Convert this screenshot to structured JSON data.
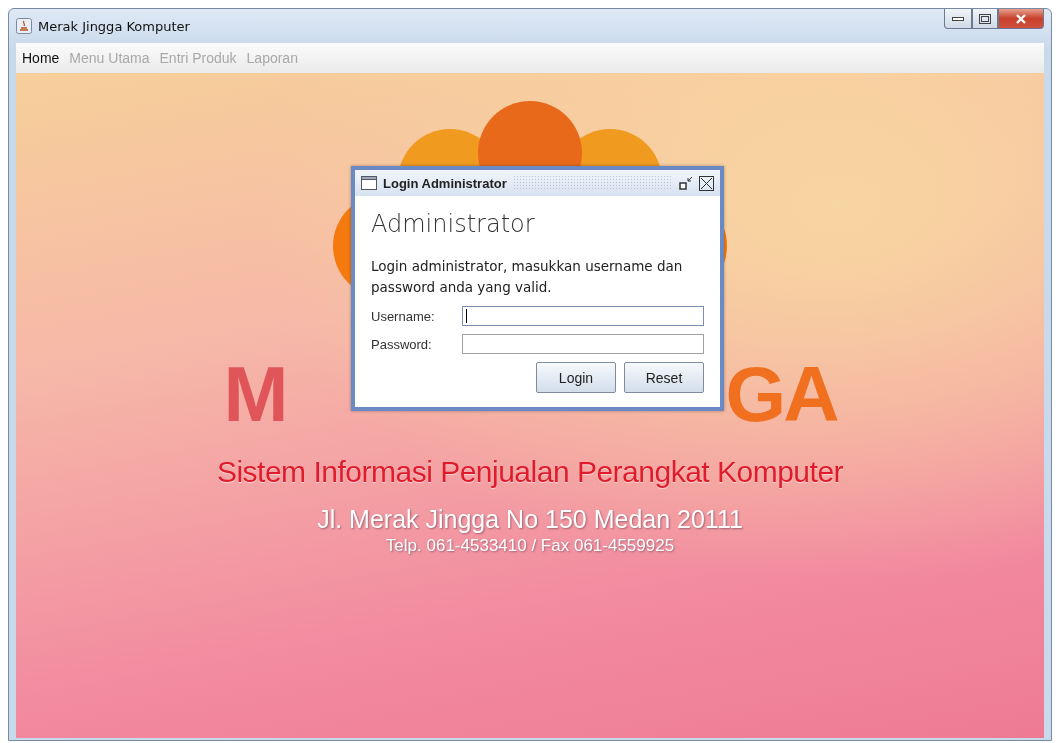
{
  "window": {
    "title": "Merak Jingga Komputer"
  },
  "menu": [
    {
      "label": "Home",
      "disabled": false
    },
    {
      "label": "Menu Utama",
      "disabled": true
    },
    {
      "label": "Entri Produk",
      "disabled": true
    },
    {
      "label": "Laporan",
      "disabled": true
    }
  ],
  "splash": {
    "brand_left": "M",
    "brand_right": "GA",
    "tagline": "Sistem Informasi Penjualan Perangkat Komputer",
    "address": "Jl. Merak Jingga No 150 Medan 20111",
    "phone": "Telp. 061-4533410 / Fax 061-4559925"
  },
  "dialog": {
    "title": "Login Administrator",
    "heading": "Administrator",
    "message": "Login administrator, masukkan username dan password anda yang valid.",
    "fields": [
      {
        "label": "Username:",
        "focused": true
      },
      {
        "label": "Password:",
        "focused": false
      }
    ],
    "buttons": [
      "Login",
      "Reset"
    ]
  }
}
